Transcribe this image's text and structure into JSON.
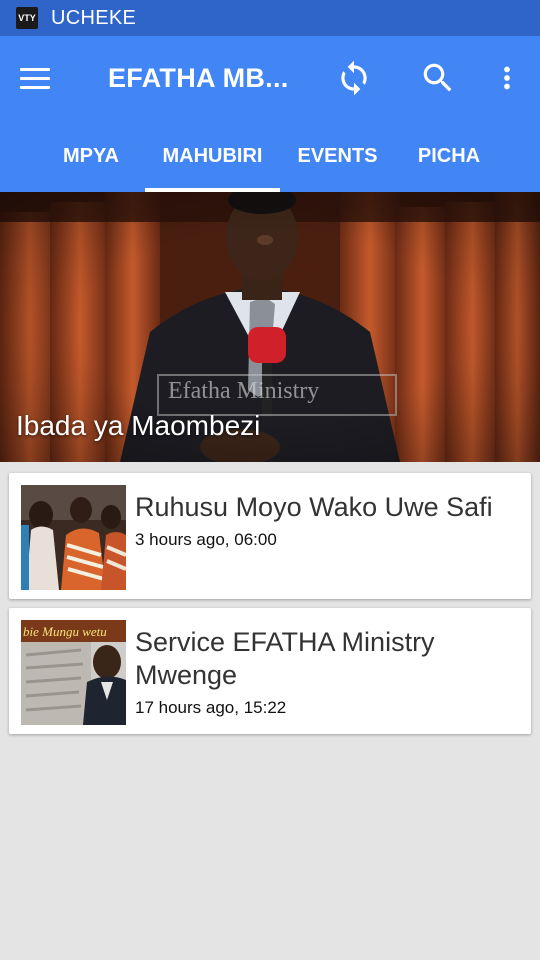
{
  "status_bar": {
    "app_icon_text": "VTY",
    "title": "UCHEKE"
  },
  "toolbar": {
    "title": "EFATHA MB...",
    "icons": [
      "menu-icon",
      "refresh-icon",
      "search-icon",
      "more-vert-icon"
    ]
  },
  "tabs": [
    {
      "label": "MPYA",
      "selected": false
    },
    {
      "label": "MAHUBIRI",
      "selected": true
    },
    {
      "label": "EVENTS",
      "selected": false
    },
    {
      "label": "PICHA",
      "selected": false
    }
  ],
  "featured": {
    "title": "Ibada ya Maombezi",
    "watermark": "Efatha Ministry"
  },
  "items": [
    {
      "title": "Ruhusu Moyo Wako Uwe Safi",
      "meta": "3 hours ago, 06:00"
    },
    {
      "title": "Service EFATHA Ministry Mwenge",
      "meta": "17 hours ago, 15:22",
      "thumb_text": "bie Mungu wetu"
    }
  ],
  "colors": {
    "status_bar": "#2f64c8",
    "app_bar": "#4285f4",
    "background": "#e4e4e4"
  }
}
